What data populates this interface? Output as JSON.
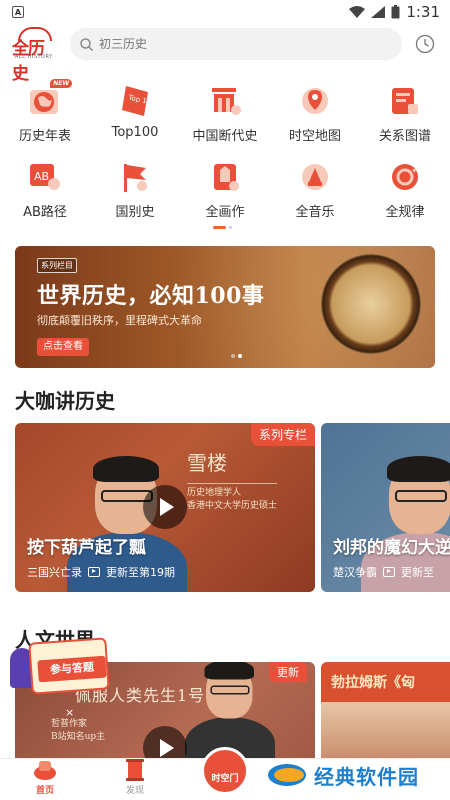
{
  "status_bar": {
    "app_glyph": "A",
    "time": "1:31"
  },
  "header": {
    "logo_text": "全历史",
    "logo_subtext": "ALL HISTORY",
    "search_placeholder": "初三历史"
  },
  "shortcuts": [
    {
      "label": "历史年表",
      "icon": "world-timeline-icon",
      "badge": "NEW"
    },
    {
      "label": "Top100",
      "icon": "top100-icon",
      "badge_text": "Top 100"
    },
    {
      "label": "中国断代史",
      "icon": "chinese-dynasty-icon"
    },
    {
      "label": "时空地图",
      "icon": "map-icon"
    },
    {
      "label": "关系图谱",
      "icon": "relationship-graph-icon"
    },
    {
      "label": "AB路径",
      "icon": "ab-path-icon",
      "badge_text": "AB"
    },
    {
      "label": "国别史",
      "icon": "country-flag-icon"
    },
    {
      "label": "全画作",
      "icon": "painting-icon"
    },
    {
      "label": "全音乐",
      "icon": "music-icon"
    },
    {
      "label": "全规律",
      "icon": "pattern-icon"
    }
  ],
  "banner": {
    "tag": "系列栏目",
    "title": "世界历史，必知100事",
    "subtitle": "彻底颠覆旧秩序，里程碑式大革命",
    "button": "点击查看"
  },
  "section_lectures": {
    "title": "大咖讲历史",
    "cards": [
      {
        "badge": "系列专栏",
        "name": "雪楼",
        "role_line1": "历史地理学人",
        "role_line2": "香港中文大学历史硕士",
        "title": "按下葫芦起了瓢",
        "series": "三国兴亡录",
        "update": "更新至第19期"
      },
      {
        "title": "刘邦的魔幻大逆",
        "series": "楚汉争霸",
        "update": "更新至"
      }
    ]
  },
  "section_culture": {
    "title": "人文世界",
    "quiz_label": "参与答题",
    "cards": [
      {
        "badge": "更新",
        "title": "佩服人类先生1号",
        "role_line1": "哲普作家",
        "role_line2": "B站知名up主",
        "mark": "×"
      },
      {
        "title": "勃拉姆斯《匈"
      }
    ]
  },
  "bottom_nav": [
    {
      "label": "首页",
      "icon": "home-icon",
      "active": true
    },
    {
      "label": "发现",
      "icon": "discover-scroll-icon",
      "active": false
    },
    {
      "label": "时空门",
      "icon": "time-portal-icon",
      "active": false
    }
  ],
  "watermark": {
    "text": "经典软件园"
  },
  "colors": {
    "accent": "#e8503a",
    "logo_red": "#d93025",
    "watermark_blue": "#1d7fcf"
  }
}
